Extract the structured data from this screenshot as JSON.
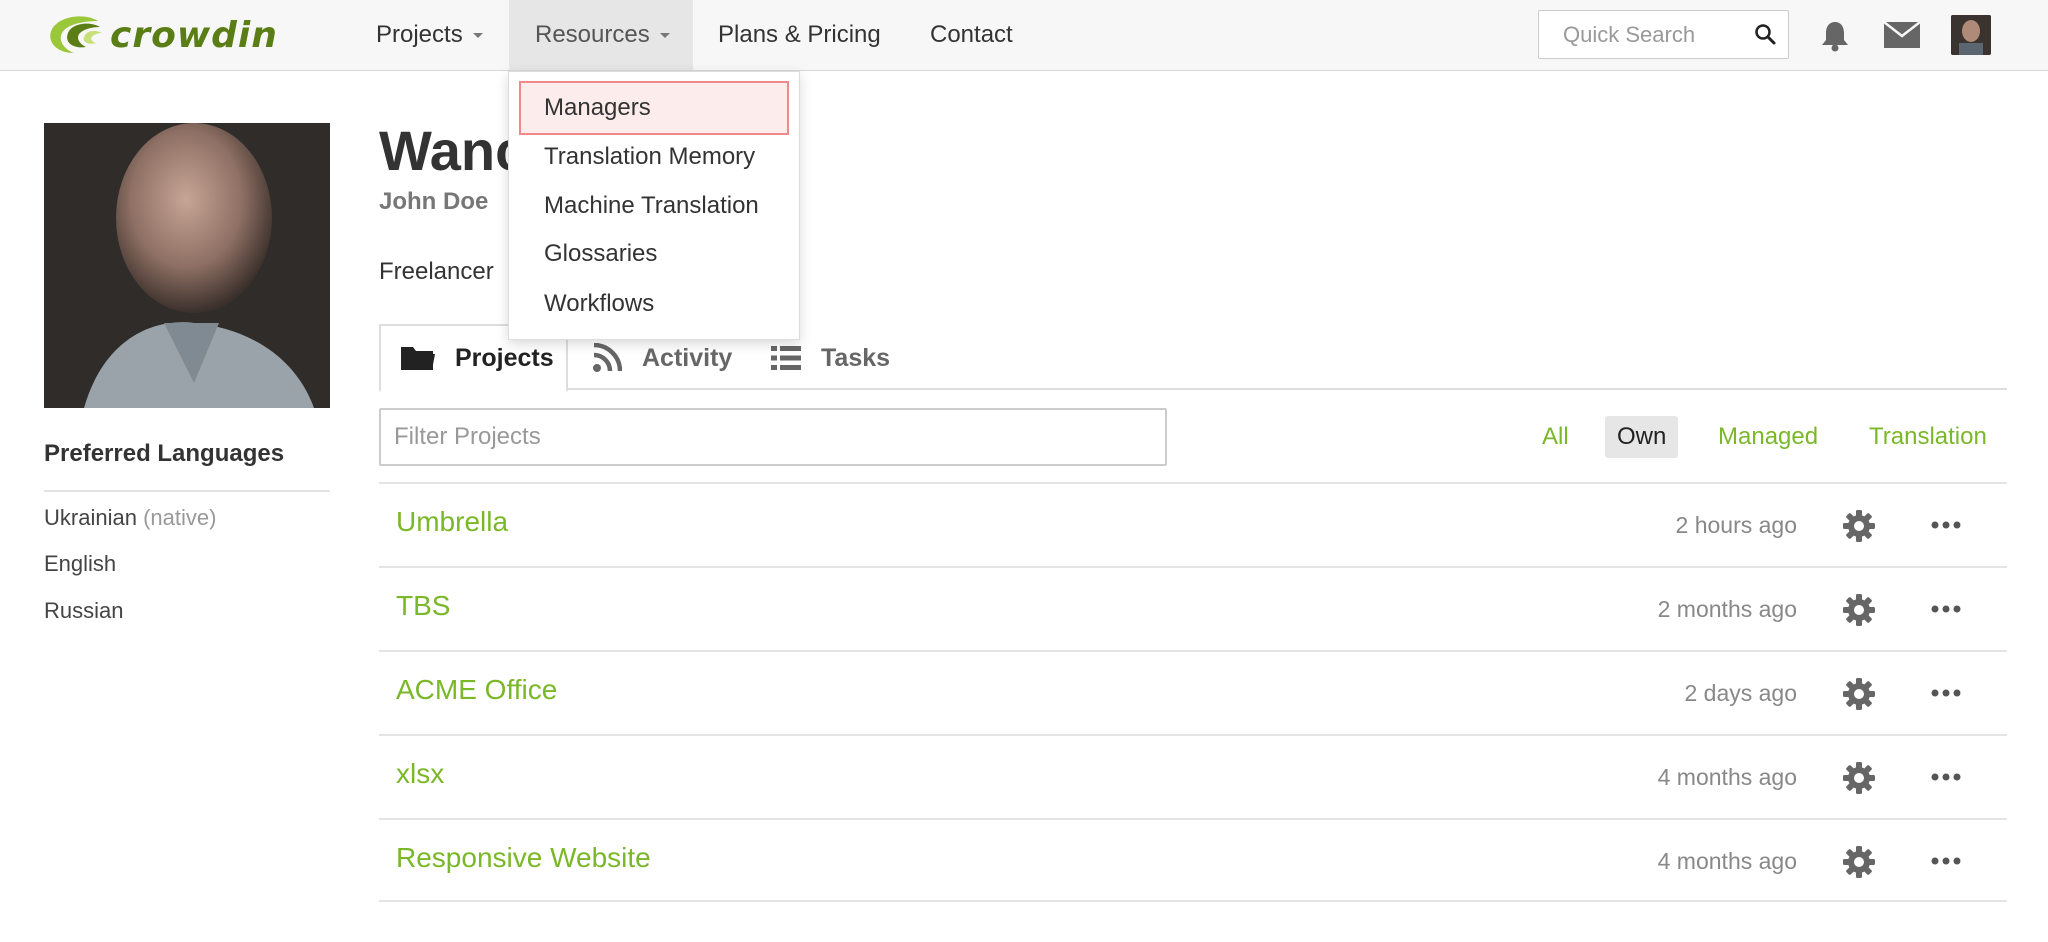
{
  "brand": {
    "logo_text": "crowdin",
    "accent_color": "#7ab828"
  },
  "nav": {
    "projects_label": "Projects",
    "resources_label": "Resources",
    "plans_label": "Plans & Pricing",
    "contact_label": "Contact",
    "search_placeholder": "Quick Search"
  },
  "resources_menu": {
    "items": [
      {
        "label": "Managers"
      },
      {
        "label": "Translation Memory"
      },
      {
        "label": "Machine Translation"
      },
      {
        "label": "Glossaries"
      },
      {
        "label": "Workflows"
      }
    ]
  },
  "profile": {
    "title_visible": "Wanc",
    "name": "John Doe",
    "role": "Freelancer"
  },
  "sidebar": {
    "title": "Preferred Languages",
    "languages": [
      {
        "name": "Ukrainian",
        "note": "(native)"
      },
      {
        "name": "English",
        "note": ""
      },
      {
        "name": "Russian",
        "note": ""
      }
    ]
  },
  "tabs": [
    {
      "label": "Projects",
      "icon": "folder-icon",
      "active": true
    },
    {
      "label": "Activity",
      "icon": "rss-icon",
      "active": false
    },
    {
      "label": "Tasks",
      "icon": "list-icon",
      "active": false
    }
  ],
  "filter": {
    "placeholder": "Filter Projects",
    "options": [
      {
        "label": "All",
        "selected": false
      },
      {
        "label": "Own",
        "selected": true
      },
      {
        "label": "Managed",
        "selected": false
      },
      {
        "label": "Translation",
        "selected": false
      }
    ]
  },
  "projects": [
    {
      "name": "Umbrella",
      "updated": "2 hours ago"
    },
    {
      "name": "TBS",
      "updated": "2 months ago"
    },
    {
      "name": "ACME Office",
      "updated": "2 days ago"
    },
    {
      "name": "xlsx",
      "updated": "4 months ago"
    },
    {
      "name": "Responsive Website",
      "updated": "4 months ago"
    }
  ]
}
